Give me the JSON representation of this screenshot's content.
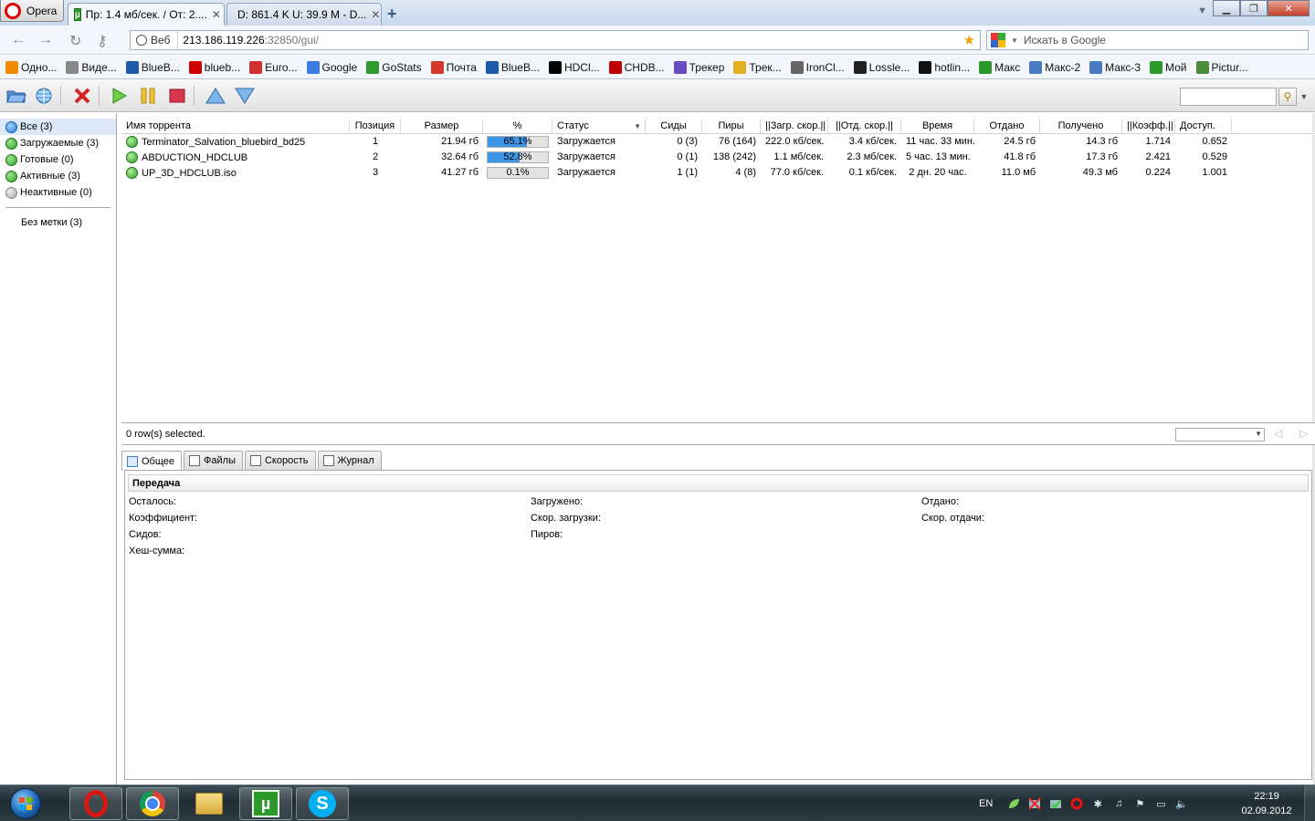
{
  "browser": {
    "menu_label": "Opera",
    "tabs": [
      {
        "label": "Пр: 1.4 мб/сек. / От: 2....",
        "active": true
      },
      {
        "label": "D: 861.4 K U: 39.9 M - D...",
        "active": false
      }
    ],
    "address": {
      "prefix": "Веб",
      "host": "213.186.119.226",
      "port_path": ":32850/gui/"
    },
    "search_placeholder": "Искать в Google",
    "bookmarks": [
      {
        "label": "Одно...",
        "icon": "odnoklassniki-icon",
        "color": "#f28a00"
      },
      {
        "label": "Виде...",
        "icon": "video-icon",
        "color": "#888888"
      },
      {
        "label": "BlueB...",
        "icon": "bluebird-icon",
        "color": "#1e5aa8"
      },
      {
        "label": "blueb...",
        "icon": "youtube-icon",
        "color": "#d00000"
      },
      {
        "label": "Euro...",
        "icon": "euro-icon",
        "color": "#d03030"
      },
      {
        "label": "Google",
        "icon": "google-icon",
        "color": "#3b7de0"
      },
      {
        "label": "GoStats",
        "icon": "gostats-icon",
        "color": "#2e9a2e"
      },
      {
        "label": "Почта",
        "icon": "gmail-icon",
        "color": "#d33a2c"
      },
      {
        "label": "BlueB...",
        "icon": "bluebird-icon",
        "color": "#1e5aa8"
      },
      {
        "label": "HDCl...",
        "icon": "hdclub-icon",
        "color": "#000000"
      },
      {
        "label": "CHDB...",
        "icon": "chdbits-icon",
        "color": "#c00000"
      },
      {
        "label": "Трекер",
        "icon": "tracker-icon",
        "color": "#6a4cc2"
      },
      {
        "label": "Трек...",
        "icon": "tracker2-icon",
        "color": "#e0b020"
      },
      {
        "label": "IronCl...",
        "icon": "ironclub-icon",
        "color": "#666666"
      },
      {
        "label": "Lossle...",
        "icon": "lossless-icon",
        "color": "#222222"
      },
      {
        "label": "hotlin...",
        "icon": "hotline-icon",
        "color": "#111111"
      },
      {
        "label": "Макс",
        "icon": "utorrent-icon",
        "color": "#2c9a2a"
      },
      {
        "label": "Макс-2",
        "icon": "deluge-icon",
        "color": "#4a7ac1"
      },
      {
        "label": "Макс-3",
        "icon": "deluge-icon",
        "color": "#4a7ac1"
      },
      {
        "label": "Мой",
        "icon": "utorrent-icon",
        "color": "#2c9a2a"
      },
      {
        "label": "Pictur...",
        "icon": "pictures-icon",
        "color": "#4a8a3a"
      }
    ]
  },
  "categories": [
    {
      "label": "Все (3)",
      "selected": true,
      "icon": "all-torrents-icon"
    },
    {
      "label": "Загружаемые (3)",
      "selected": false,
      "icon": "downloading-icon"
    },
    {
      "label": "Готовые (0)",
      "selected": false,
      "icon": "completed-icon"
    },
    {
      "label": "Активные (3)",
      "selected": false,
      "icon": "active-icon"
    },
    {
      "label": "Неактивные (0)",
      "selected": false,
      "icon": "inactive-icon"
    }
  ],
  "label_category": "Без метки (3)",
  "columns": [
    "Имя торрента",
    "Позиция",
    "Размер",
    "%",
    "Статус",
    "Сиды",
    "Пиры",
    "||Загр. скор.||",
    "||Отд. скор.||",
    "Время",
    "Отдано",
    "Получено",
    "||Коэфф.||",
    "Доступ."
  ],
  "torrents": [
    {
      "name": "Terminator_Salvation_bluebird_bd25",
      "position": "1",
      "size": "21.94 гб",
      "percent": "65.1%",
      "progress": 0.651,
      "status": "Загружается",
      "seeds": "0 (3)",
      "peers": "76 (164)",
      "down_speed": "222.0 кб/сек.",
      "up_speed": "3.4 кб/сек.",
      "eta": "11 час. 33 мин.",
      "uploaded": "24.5 гб",
      "downloaded": "14.3 гб",
      "ratio": "1.714",
      "availability": "0.652"
    },
    {
      "name": "ABDUCTION_HDCLUB",
      "position": "2",
      "size": "32.64 гб",
      "percent": "52.8%",
      "progress": 0.528,
      "status": "Загружается",
      "seeds": "0 (1)",
      "peers": "138 (242)",
      "down_speed": "1.1 мб/сек.",
      "up_speed": "2.3 мб/сек.",
      "eta": "5 час. 13 мин.",
      "uploaded": "41.8 гб",
      "downloaded": "17.3 гб",
      "ratio": "2.421",
      "availability": "0.529"
    },
    {
      "name": "UP_3D_HDCLUB.iso",
      "position": "3",
      "size": "41.27 гб",
      "percent": "0.1%",
      "progress": 0.001,
      "status": "Загружается",
      "seeds": "1 (1)",
      "peers": "4 (8)",
      "down_speed": "77.0 кб/сек.",
      "up_speed": "0.1 кб/сек.",
      "eta": "2 дн. 20 час.",
      "uploaded": "11.0 мб",
      "downloaded": "49.3 мб",
      "ratio": "0.224",
      "availability": "1.001"
    }
  ],
  "status_bar": {
    "selected_text": "0 row(s) selected."
  },
  "detail_tabs": [
    {
      "label": "Общее",
      "active": true,
      "icon": "general-tab-icon"
    },
    {
      "label": "Файлы",
      "active": false,
      "icon": "files-tab-icon"
    },
    {
      "label": "Скорость",
      "active": false,
      "icon": "speed-tab-icon"
    },
    {
      "label": "Журнал",
      "active": false,
      "icon": "log-tab-icon"
    }
  ],
  "transfer": {
    "title": "Передача",
    "remaining": "Осталось:",
    "ratio": "Коэффициент:",
    "seeds": "Сидов:",
    "hash": "Хеш-сумма:",
    "downloaded": "Загружено:",
    "down_speed": "Скор. загрузки:",
    "peers": "Пиров:",
    "uploaded": "Отдано:",
    "up_speed": "Скор. отдачи:"
  },
  "taskbar": {
    "language": "EN",
    "time": "22:19",
    "date": "02.09.2012"
  },
  "colors": {
    "progress_fill": "#3d95e6",
    "accent": "#2c9a2a"
  }
}
